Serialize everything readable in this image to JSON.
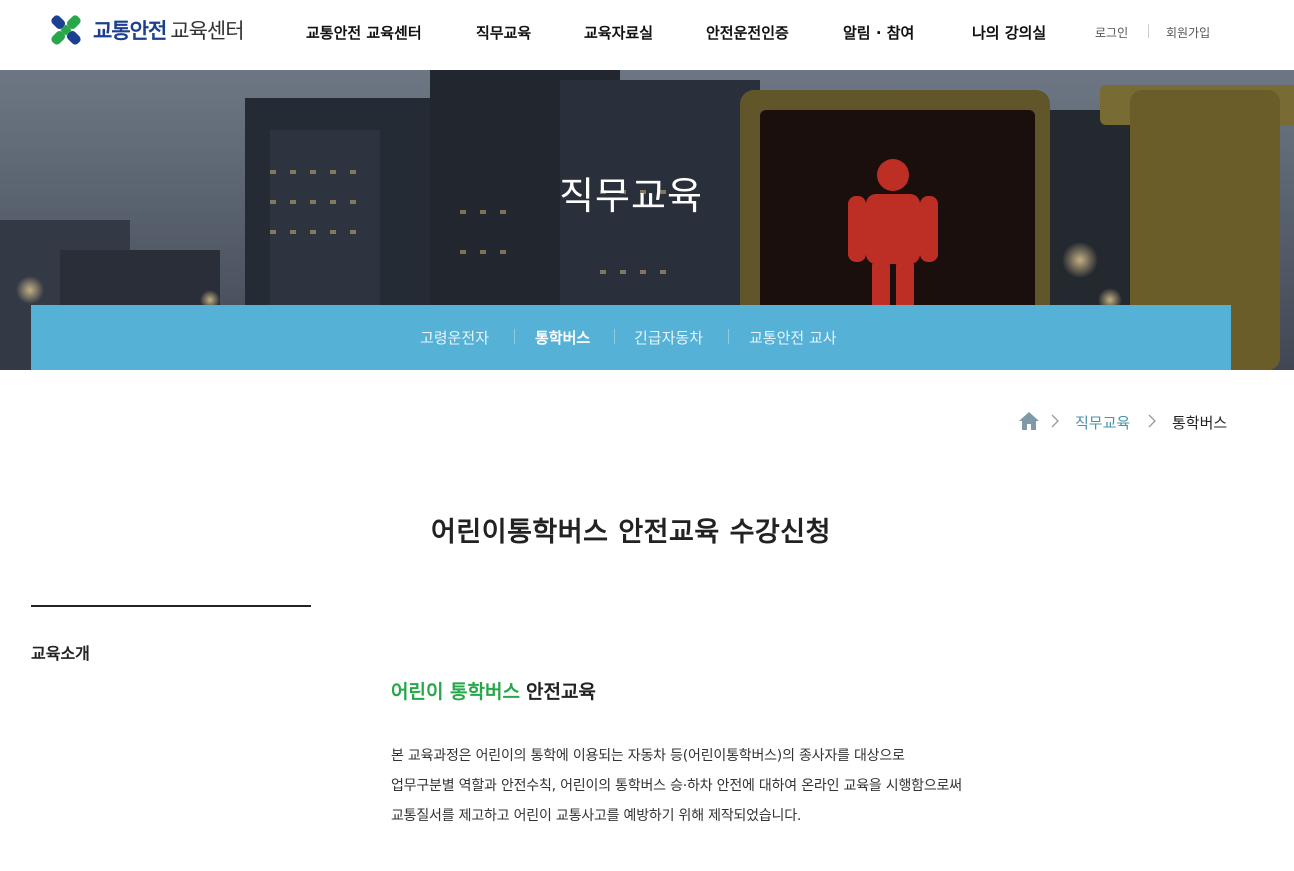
{
  "header": {
    "logo": {
      "strong": "교통안전",
      "light": "교육센터"
    },
    "nav": [
      "교통안전 교육센터",
      "직무교육",
      "교육자료실",
      "안전운전인증",
      "알림 · 참여",
      "나의 강의실"
    ],
    "login": "로그인",
    "signup": "회원가입"
  },
  "hero": {
    "title": "직무교육",
    "subnav": [
      "고령운전자",
      "통학버스",
      "긴급자동차",
      "교통안전 교사"
    ],
    "active_subnav": "통학버스"
  },
  "breadcrumb": {
    "home_icon": "home-icon",
    "items": [
      "직무교육",
      "통학버스"
    ]
  },
  "page": {
    "title": "어린이통학버스 안전교육 수강신청"
  },
  "sidebar": {
    "label": "교육소개"
  },
  "content": {
    "heading_highlight": "어린이 통학버스",
    "heading_rest": "안전교육",
    "paragraph": [
      "본 교육과정은 어린이의 통학에 이용되는 자동차 등(어린이통학버스)의 종사자를 대상으로",
      "업무구분별 역할과 안전수칙, 어린이의 통학버스 승·하차 안전에 대하여 온라인 교육을 시행함으로써",
      "교통질서를 제고하고 어린이 교통사고를 예방하기 위해 제작되었습니다."
    ]
  },
  "colors": {
    "brand_blue": "#1d3f8f",
    "brand_green": "#27a74a",
    "subnav_bg": "#55b2d6",
    "crumb_link": "#4a93ab"
  }
}
